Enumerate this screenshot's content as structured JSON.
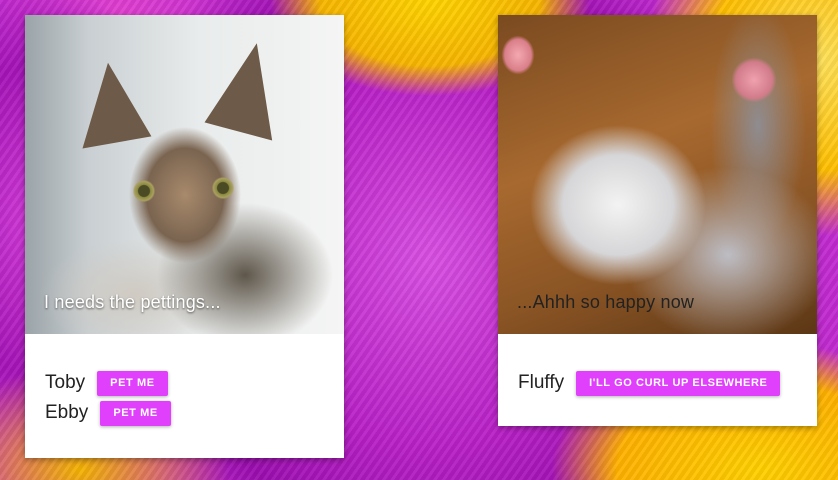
{
  "cards": [
    {
      "caption": "I needs the pettings...",
      "people": [
        {
          "name": "Toby",
          "button": "PET ME"
        },
        {
          "name": "Ebby",
          "button": "PET ME"
        }
      ]
    },
    {
      "caption": "...Ahhh so happy now",
      "people": [
        {
          "name": "Fluffy",
          "button": "I'LL GO CURL UP ELSEWHERE"
        }
      ]
    }
  ],
  "colors": {
    "accent": "#e040fb",
    "background_primary": "#c12ad0",
    "background_secondary": "#ffd000"
  },
  "images": {
    "card_1": "tabby-kitten-photo",
    "card_2": "gray-kitten-paws-up-photo",
    "background": "yarn-balls-background"
  }
}
